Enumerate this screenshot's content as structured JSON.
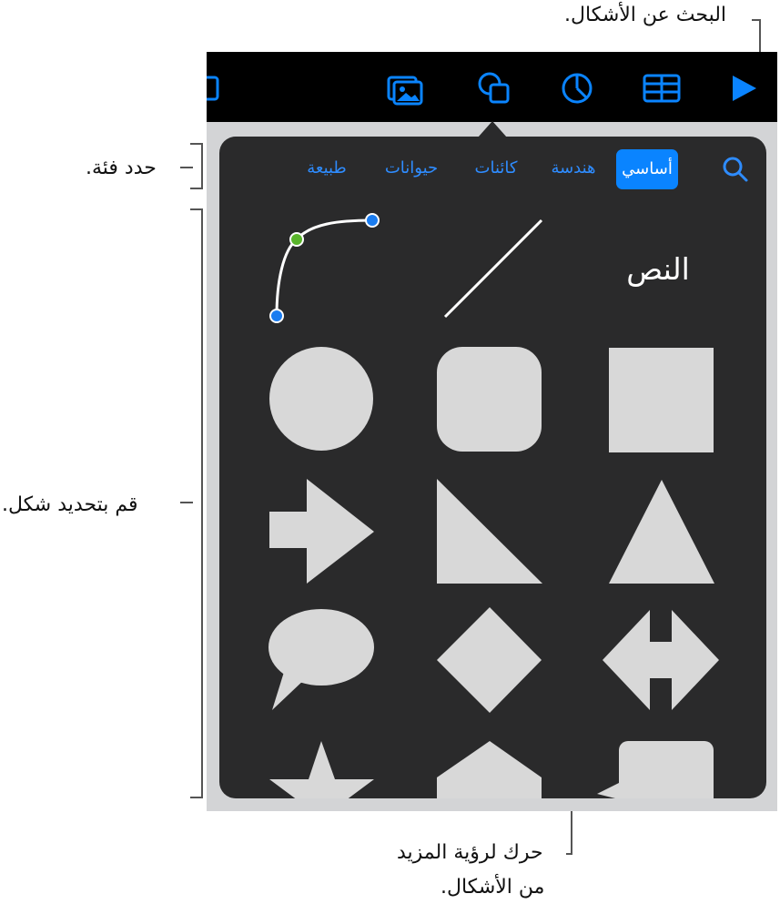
{
  "callouts": {
    "search": "البحث عن الأشكال.",
    "category": "حدد فئة.",
    "shape": "قم بتحديد شكل.",
    "scroll_line1": "حرك لرؤية المزيد",
    "scroll_line2": "من الأشكال."
  },
  "toolbar": {
    "icons": [
      "table-icon",
      "media-icon",
      "shapes-icon",
      "chart-icon",
      "table-grid-icon",
      "play-icon"
    ]
  },
  "tabs": [
    {
      "label": "أساسي",
      "active": true
    },
    {
      "label": "هندسة",
      "active": false
    },
    {
      "label": "كائنات",
      "active": false
    },
    {
      "label": "حيوانات",
      "active": false
    },
    {
      "label": "طبيعة",
      "active": false
    }
  ],
  "shapes": {
    "text_label": "النص"
  },
  "colors": {
    "accent": "#0a84ff",
    "shape_fill": "#d8d8d8",
    "popover_bg": "#2a2a2b",
    "point_blue": "#1a7cf0",
    "point_green": "#5ab52c"
  }
}
